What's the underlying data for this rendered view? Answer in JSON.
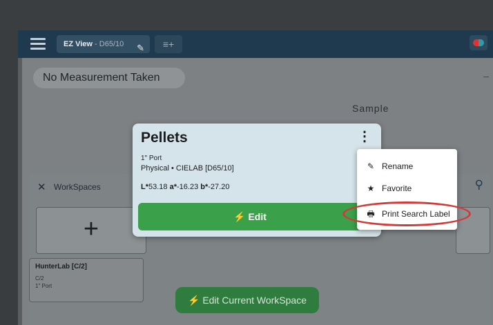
{
  "toolbar": {
    "ez_tab_label": "EZ View",
    "ez_tab_sub": "- D65/10",
    "add_tab_icon": "tab-add-icon",
    "menu_icon": "hamburger-icon",
    "edit_icon": "pencil-icon",
    "swatch_icon": "color-swatch-icon"
  },
  "measurement": {
    "status": "No Measurement Taken",
    "minus": "–"
  },
  "sample_label": "Sample",
  "workspaces": {
    "title": "WorkSpaces",
    "add_label": "+",
    "items": [
      {
        "name": "HunterLab [C/2]",
        "line1": "C/2",
        "line2": "1\" Port"
      }
    ]
  },
  "popup": {
    "title": "Pellets",
    "port": "1\" Port",
    "mode": "Physical • CIELAB [D65/10]",
    "l_label": "L*",
    "l_value": "53.18",
    "a_label": "a*",
    "a_value": "-16.23",
    "b_label": "b*",
    "b_value": "-27.20",
    "edit_label": "Edit",
    "more_icon": "⋮"
  },
  "context_menu": {
    "items": [
      {
        "label": "Rename",
        "icon": "rename-icon"
      },
      {
        "label": "Favorite",
        "icon": "star-icon"
      },
      {
        "label": "Print Search Label",
        "icon": "printer-icon"
      }
    ]
  },
  "edit_workspace_label": "Edit Current WorkSpace",
  "colors": {
    "toolbar": "#1f3a4e",
    "popup_bg": "#d5e4ea",
    "edit_green": "#3aa049",
    "highlight_red": "#d23a3a"
  }
}
